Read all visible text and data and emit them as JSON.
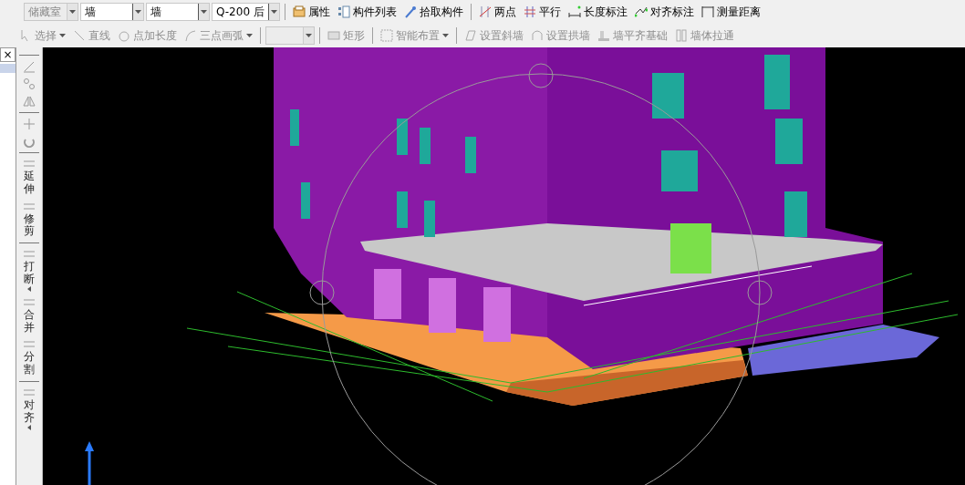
{
  "side_panel": {
    "close_button": "×"
  },
  "toolbar_row1": {
    "combos": [
      {
        "value": "储藏室",
        "disabled": true
      },
      {
        "value": "墙",
        "disabled": false
      },
      {
        "value": "墙",
        "disabled": false
      },
      {
        "value": "Q-200 后",
        "disabled": false
      }
    ],
    "groups": [
      [
        "属性",
        "构件列表",
        "拾取构件"
      ],
      [
        "两点",
        "平行",
        "长度标注",
        "对齐标注",
        "测量距离"
      ]
    ]
  },
  "toolbar_row2": {
    "items": [
      {
        "kind": "button",
        "label": "选择",
        "dropdown": true,
        "disabled": true
      },
      {
        "kind": "button",
        "label": "直线",
        "dropdown": false,
        "disabled": true
      },
      {
        "kind": "button",
        "label": "点加长度",
        "dropdown": false,
        "disabled": true
      },
      {
        "kind": "button",
        "label": "三点画弧",
        "dropdown": true,
        "disabled": true
      },
      {
        "kind": "combo",
        "disabled": true
      },
      {
        "kind": "button",
        "label": "矩形",
        "dropdown": false,
        "disabled": true
      },
      {
        "kind": "button",
        "label": "智能布置",
        "dropdown": true,
        "disabled": true
      },
      {
        "kind": "button",
        "label": "设置斜墙",
        "dropdown": false,
        "disabled": true
      },
      {
        "kind": "button",
        "label": "设置拱墙",
        "dropdown": false,
        "disabled": true
      },
      {
        "kind": "button",
        "label": "墙平齐基础",
        "dropdown": false,
        "disabled": true
      },
      {
        "kind": "button",
        "label": "墙体拉通",
        "dropdown": false,
        "disabled": true
      }
    ]
  },
  "vertical_toolbar": {
    "labeled_tools": [
      {
        "label": "延伸",
        "dropdown": false
      },
      {
        "label": "修剪",
        "dropdown": false
      },
      {
        "label": "打断",
        "dropdown": true
      },
      {
        "label": "合并",
        "dropdown": false
      },
      {
        "label": "分割",
        "dropdown": false
      },
      {
        "label": "对齐",
        "dropdown": true
      }
    ]
  }
}
